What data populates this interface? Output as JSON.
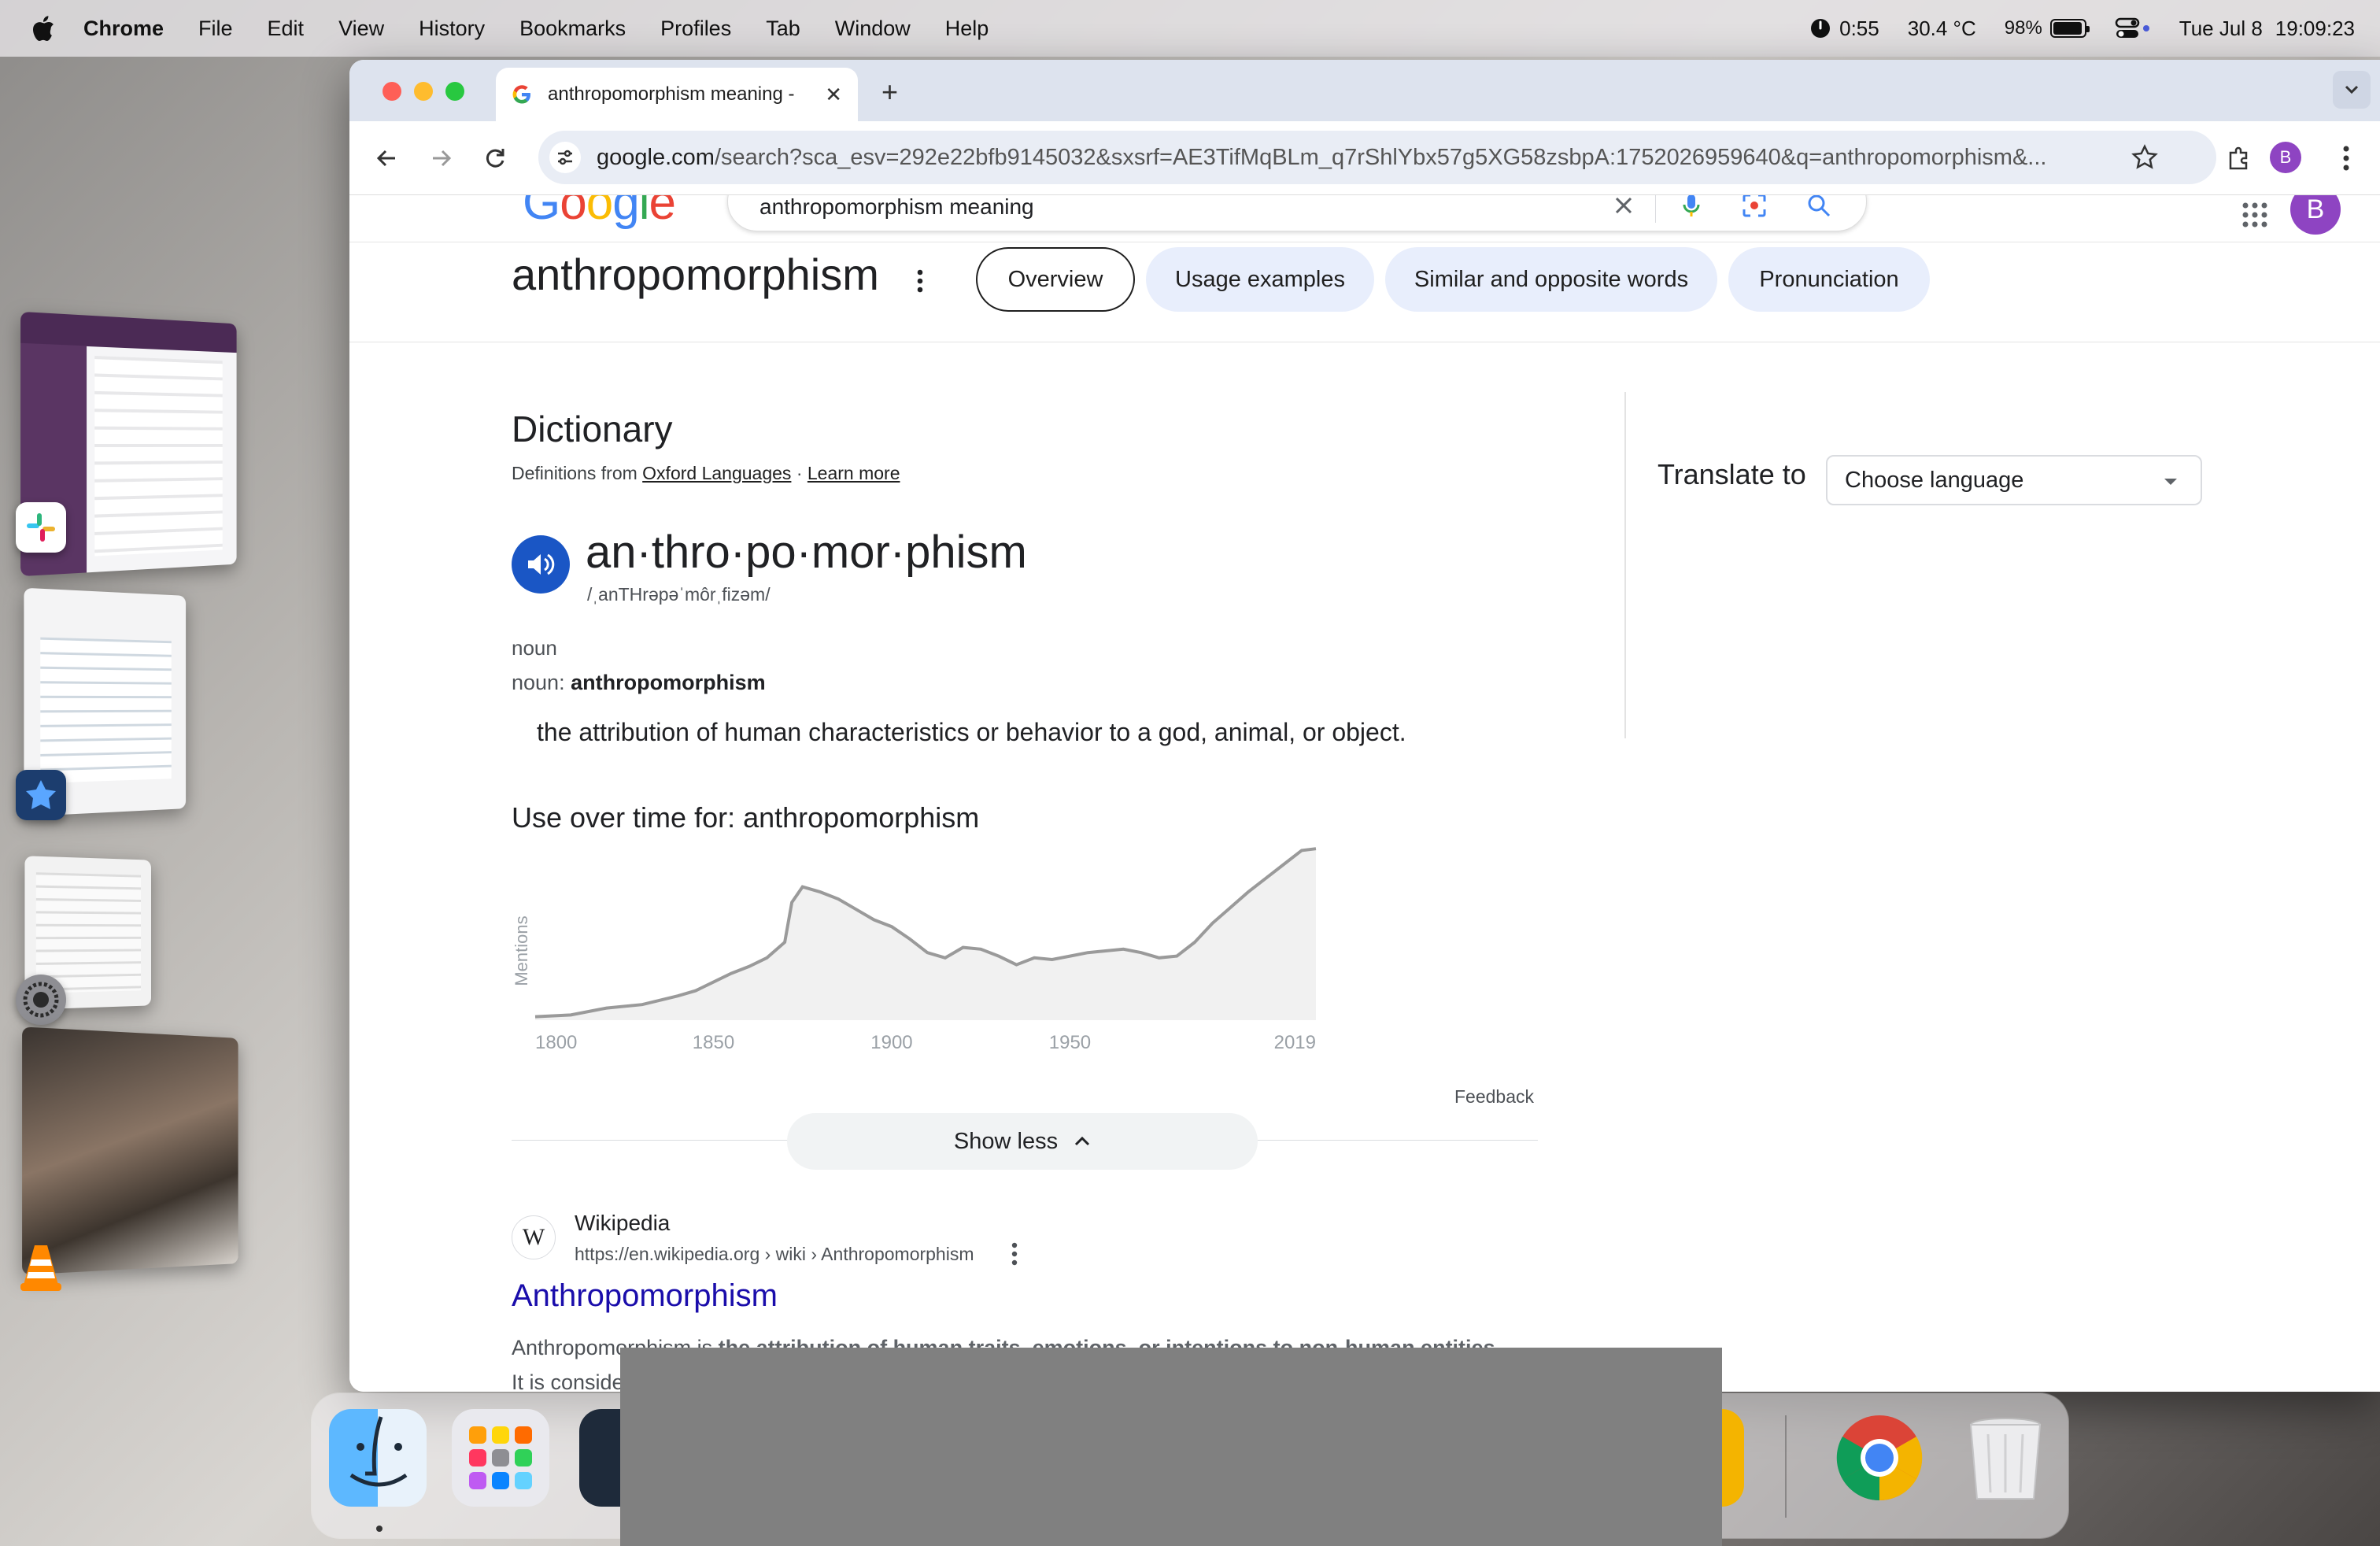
{
  "menubar": {
    "app": "Chrome",
    "items": [
      "File",
      "Edit",
      "View",
      "History",
      "Bookmarks",
      "Profiles",
      "Tab",
      "Window",
      "Help"
    ],
    "timer": "0:55",
    "temperature": "30.4 °C",
    "battery": "98%",
    "date": "Tue Jul 8",
    "time": "19:09:23"
  },
  "browser": {
    "tab_title": "anthropomorphism meaning - ",
    "url_host": "google.com",
    "url_path": "/search?sca_esv=292e22bfb9145032&sxsrf=AE3TifMqBLm_q7rShlYbx57g5XG58zsbpA:1752026959640&q=anthropomorphism&...",
    "profile_initial": "B"
  },
  "google": {
    "logo": "Google",
    "query": "anthropomorphism meaning",
    "profile_initial": "B"
  },
  "result": {
    "word": "anthropomorphism",
    "chips": [
      "Overview",
      "Usage examples",
      "Similar and opposite words",
      "Pronunciation"
    ],
    "dictionary_label": "Dictionary",
    "definitions_from": "Definitions from",
    "oxford_link": "Oxford Languages",
    "separator": "·",
    "learn_more": "Learn more",
    "syllables": "an·thro·po·mor·phism",
    "pronunciation": "/ˌanTHrəpəˈmôrˌfizəm/",
    "pos": "noun",
    "noun_prefix": "noun:",
    "noun_word": "anthropomorphism",
    "definition": "the attribution of human characteristics or behavior to a god, animal, or object.",
    "use_over_time": "Use over time for: anthropomorphism",
    "feedback": "Feedback",
    "show_less": "Show less",
    "translate_label": "Translate to",
    "language_placeholder": "Choose language"
  },
  "wiki": {
    "icon_letter": "W",
    "site": "Wikipedia",
    "url": "https://en.wikipedia.org › wiki › Anthropomorphism",
    "title": "Anthropomorphism",
    "snippet_start": "Anthropomorphism is ",
    "snippet_bold": "the attribution of human traits, emotions, or intentions to non-human entities.",
    "snippet_line2": "It is conside"
  },
  "chart_data": {
    "type": "area",
    "title": "Use over time for: anthropomorphism",
    "ylabel": "Mentions",
    "xlabel": "",
    "x_ticks": [
      "1800",
      "1850",
      "1900",
      "1950",
      "2019"
    ],
    "xlim": [
      1800,
      2019
    ],
    "ylim": [
      0,
      100
    ],
    "x": [
      1800,
      1810,
      1820,
      1830,
      1840,
      1845,
      1850,
      1855,
      1860,
      1865,
      1870,
      1872,
      1875,
      1880,
      1885,
      1890,
      1895,
      1900,
      1905,
      1910,
      1915,
      1920,
      1925,
      1930,
      1935,
      1940,
      1945,
      1950,
      1955,
      1960,
      1965,
      1970,
      1975,
      1980,
      1985,
      1990,
      1995,
      2000,
      2005,
      2010,
      2015,
      2019
    ],
    "values": [
      2,
      3,
      7,
      9,
      14,
      17,
      22,
      27,
      31,
      36,
      45,
      68,
      77,
      74,
      70,
      64,
      58,
      54,
      47,
      39,
      36,
      42,
      41,
      37,
      32,
      36,
      35,
      37,
      39,
      40,
      41,
      39,
      36,
      37,
      45,
      56,
      65,
      74,
      82,
      90,
      98,
      99
    ],
    "fill_color": "#f1f1f1",
    "line_color": "#9a9a9a"
  }
}
